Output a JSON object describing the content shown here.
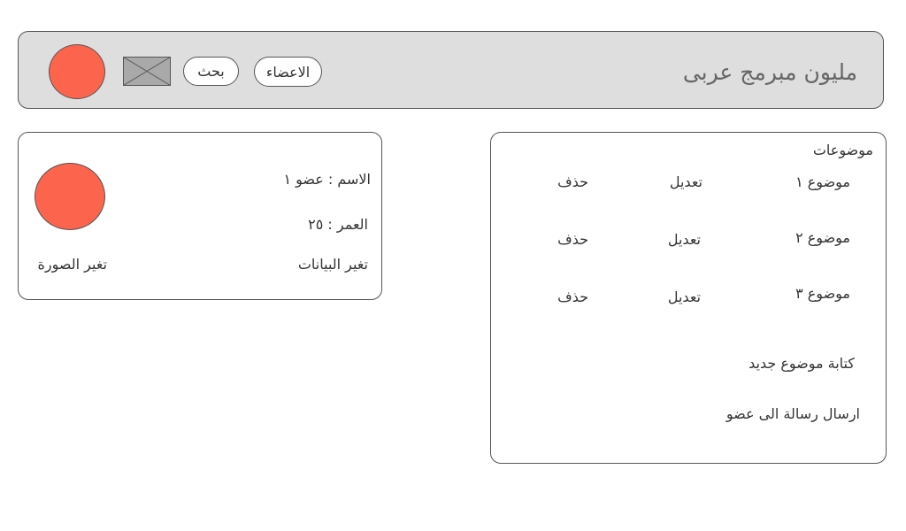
{
  "header": {
    "title": "مليون مبرمج عربى",
    "members_label": "الاعضاء",
    "search_label": "بحث",
    "logo_icon": "image-placeholder-icon",
    "avatar_icon": "user-avatar-icon"
  },
  "profile": {
    "name_line": "الاسم : عضو ١",
    "age_line": "العمر : ٢٥",
    "edit_data_label": "تغير البيانات",
    "change_photo_label": "تغير الصورة",
    "avatar_icon": "profile-photo-icon"
  },
  "topics": {
    "heading": "موضوعات",
    "items": [
      {
        "title": "موضوع ١",
        "edit_label": "تعديل",
        "delete_label": "حذف"
      },
      {
        "title": "موضوع ٢",
        "edit_label": "تعديل",
        "delete_label": "حذف"
      },
      {
        "title": "موضوع ٣",
        "edit_label": "تعديل",
        "delete_label": "حذف"
      }
    ],
    "new_topic_label": "كتابة موضوع جديد",
    "send_message_label": "ارسال رسالة الى عضو"
  },
  "colors": {
    "accent": "#fd644d",
    "header_bg": "#dedede",
    "border": "#555555"
  }
}
